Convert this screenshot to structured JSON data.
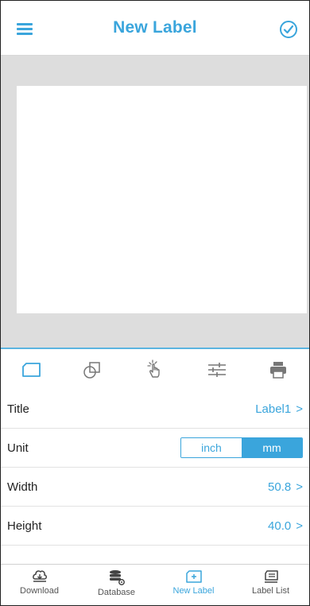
{
  "header": {
    "title": "New Label"
  },
  "icons": {
    "menu": "menu-icon",
    "confirm": "check-circle-icon"
  },
  "toolbar": {
    "tools": [
      {
        "icon": "label-shape-icon"
      },
      {
        "icon": "shapes-icon"
      },
      {
        "icon": "touch-select-icon"
      },
      {
        "icon": "sliders-icon"
      },
      {
        "icon": "printer-icon"
      }
    ]
  },
  "properties": {
    "title": {
      "label": "Title",
      "value": "Label1",
      "chevron": ">"
    },
    "unit": {
      "label": "Unit",
      "options": [
        "inch",
        "mm"
      ],
      "selected": "mm"
    },
    "width": {
      "label": "Width",
      "value": "50.8",
      "chevron": ">"
    },
    "height": {
      "label": "Height",
      "value": "40.0",
      "chevron": ">"
    }
  },
  "bottom_nav": {
    "items": [
      {
        "label": "Download",
        "icon": "download-icon"
      },
      {
        "label": "Database",
        "icon": "database-icon"
      },
      {
        "label": "New Label",
        "icon": "new-label-icon",
        "active": true
      },
      {
        "label": "Label List",
        "icon": "label-list-icon"
      }
    ]
  },
  "colors": {
    "accent": "#3aa5dc",
    "canvas_bg": "#dddddd"
  }
}
